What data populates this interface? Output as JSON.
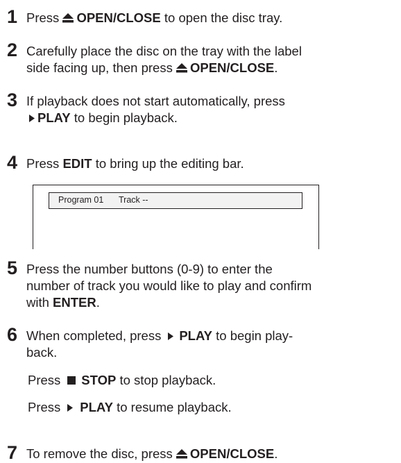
{
  "steps": [
    {
      "num": "1",
      "pre": "Press ",
      "btn": "OPEN/CLOSE",
      "post": " to open the disc tray."
    },
    {
      "num": "2",
      "line1": "Carefully place the disc on the tray with the label",
      "line2_pre": "side facing up, then press ",
      "btn": "OPEN/CLOSE",
      "post": "."
    },
    {
      "num": "3",
      "line1": "If playback does not start automatically, press",
      "btn": "PLAY",
      "post": " to begin playback."
    },
    {
      "num": "4",
      "pre": "Press ",
      "btn": "EDIT",
      "post": " to bring up the editing bar."
    },
    {
      "num": "5",
      "line1": "Press the number buttons (0-9) to enter the",
      "line2": "number of track you would like to play and confirm",
      "line3_pre": "with ",
      "btn": "ENTER",
      "post": "."
    },
    {
      "num": "6",
      "line1_pre": "When completed, press",
      "btn": "PLAY",
      "line1_post": " to begin play-",
      "line2": "back."
    },
    {
      "num": "7",
      "pre": "To remove the disc, press ",
      "btn": "OPEN/CLOSE",
      "post": "."
    }
  ],
  "stop_line": {
    "pre": "Press",
    "btn": "STOP",
    "post": " to stop playback."
  },
  "resume_line": {
    "pre": "Press",
    "btn": "PLAY",
    "post": " to resume playback."
  },
  "edit_bar": {
    "program": "Program 01",
    "track": "Track --"
  },
  "icons": {
    "eject": "eject-icon",
    "play": "play-icon",
    "stop": "stop-icon"
  }
}
